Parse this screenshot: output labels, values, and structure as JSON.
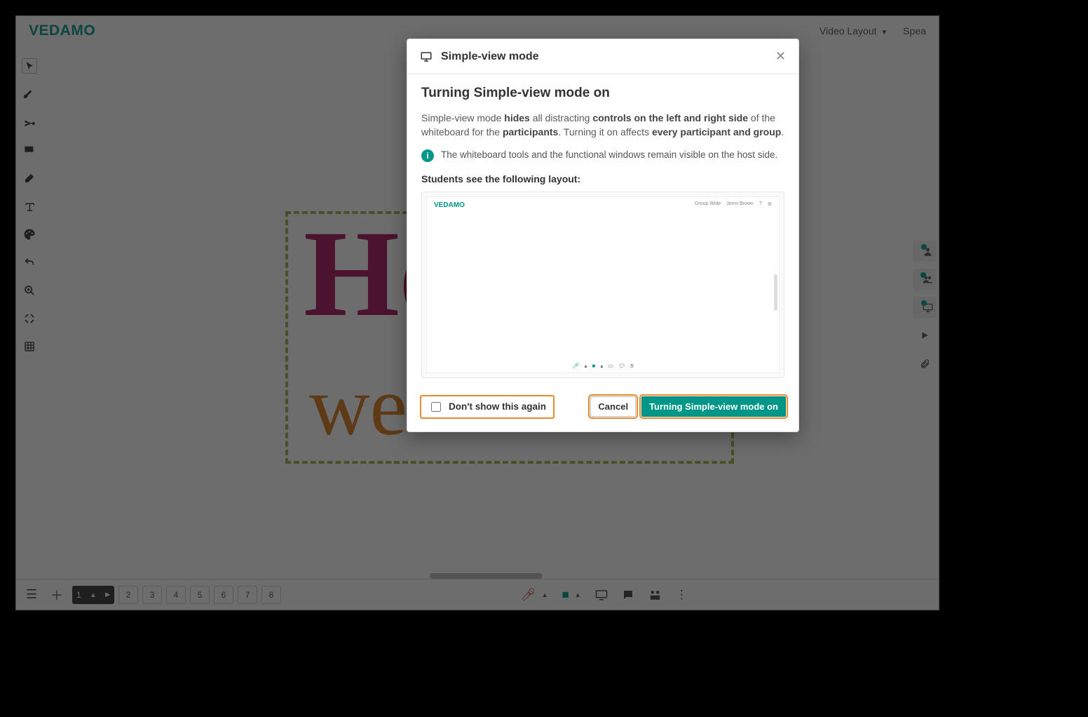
{
  "brand": "VEDAMO",
  "header": {
    "layout_label": "Video Layout",
    "right_truncated": "Spea"
  },
  "pages": {
    "active": "1",
    "list": [
      "2",
      "3",
      "4",
      "5",
      "6",
      "7",
      "8"
    ]
  },
  "modal": {
    "icon_name": "monitor",
    "title": "Simple-view mode",
    "heading": "Turning Simple-view mode on",
    "desc_pre": "Simple-view mode ",
    "desc_b1": "hides",
    "desc_mid1": " all distracting ",
    "desc_b2": "controls on the left and right side",
    "desc_mid2": " of the whiteboard for the ",
    "desc_b3": "participants",
    "desc_mid3": ". Turning it on affects ",
    "desc_b4": "every participant and group",
    "desc_end": ".",
    "note": "The whiteboard tools and the functional windows remain visible on the host side.",
    "preview_caption": "Students see the following layout:",
    "preview_tr_1": "Group Wide",
    "preview_tr_2": "Jenni Brown",
    "dont_show": "Don't show this again",
    "cancel": "Cancel",
    "confirm": "Turning Simple-view mode on"
  },
  "canvas": {
    "word1": "He",
    "word2": "we"
  }
}
